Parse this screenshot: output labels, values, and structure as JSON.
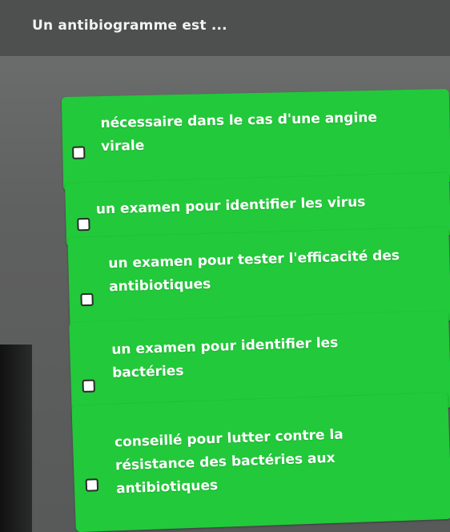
{
  "quiz": {
    "question": "Un antibiogramme est ...",
    "options": [
      {
        "label": "nécessaire dans le cas d'une angine\nvirale"
      },
      {
        "label": "un examen pour identifier les virus"
      },
      {
        "label": "un examen pour tester l'efficacité des\nantibiotiques"
      },
      {
        "label": "un examen pour identifier les\nbactéries"
      },
      {
        "label": "conseillé pour lutter contre la\nrésistance des bactéries aux\nantibiotiques"
      }
    ]
  },
  "colors": {
    "option_background": "#22c93a",
    "option_text": "#ffffff",
    "page_background": "#5f6060"
  }
}
